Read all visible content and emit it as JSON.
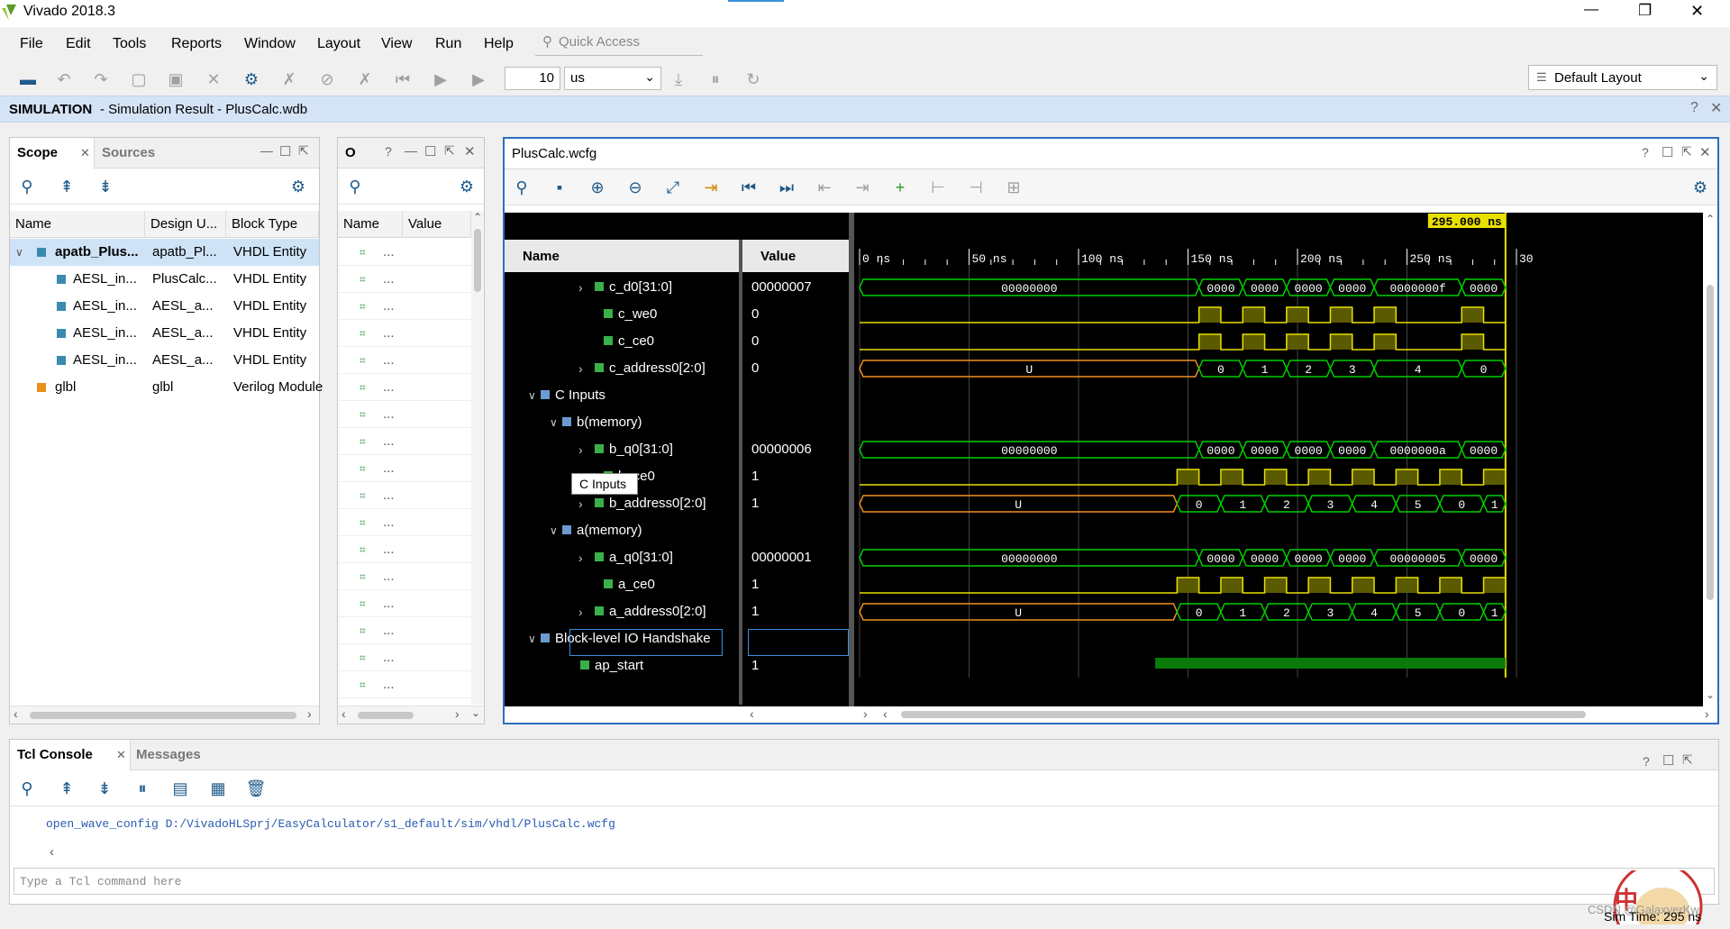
{
  "window": {
    "title": "Vivado 2018.3",
    "minimize": "—",
    "restore": "❐",
    "close": "✕"
  },
  "menu": [
    "File",
    "Edit",
    "Tools",
    "Reports",
    "Window",
    "Layout",
    "View",
    "Run",
    "Help"
  ],
  "quick_access": {
    "placeholder": "Quick Access"
  },
  "toolbar": {
    "run_time": "10",
    "time_unit": "us",
    "layout": "Default Layout"
  },
  "sim_banner": {
    "mode": "SIMULATION",
    "detail": " - Simulation Result - PlusCalc.wdb"
  },
  "scope_panel": {
    "tabs": [
      "Scope",
      "Sources"
    ],
    "columns": [
      "Name",
      "Design U...",
      "Block Type"
    ],
    "rows": [
      {
        "name": "apatb_Plus...",
        "design": "apatb_Pl...",
        "type": "VHDL Entity",
        "expanded": true,
        "selected": true
      },
      {
        "name": "AESL_in...",
        "design": "PlusCalc...",
        "type": "VHDL Entity"
      },
      {
        "name": "AESL_in...",
        "design": "AESL_a...",
        "type": "VHDL Entity"
      },
      {
        "name": "AESL_in...",
        "design": "AESL_a...",
        "type": "VHDL Entity"
      },
      {
        "name": "AESL_in...",
        "design": "AESL_a...",
        "type": "VHDL Entity"
      },
      {
        "name": "glbl",
        "design": "glbl",
        "type": "Verilog Module"
      }
    ]
  },
  "objects_panel": {
    "title": "O",
    "columns": [
      "Name",
      "Value"
    ],
    "ellipsis": "..."
  },
  "wave_panel": {
    "title": "PlusCalc.wcfg",
    "columns": [
      "Name",
      "Value"
    ],
    "cursor_label": "295.000 ns",
    "time_labels": [
      "0 ns",
      "50 ns",
      "100 ns",
      "150 ns",
      "200 ns",
      "250 ns",
      "30"
    ],
    "tooltip": "C Inputs",
    "signals": [
      {
        "name": "c_d0[31:0]",
        "value": "00000007"
      },
      {
        "name": "c_we0",
        "value": "0"
      },
      {
        "name": "c_ce0",
        "value": "0"
      },
      {
        "name": "c_address0[2:0]",
        "value": "0"
      },
      {
        "name": "C Inputs",
        "value": ""
      },
      {
        "name": "b(memory)",
        "value": ""
      },
      {
        "name": "b_q0[31:0]",
        "value": "00000006"
      },
      {
        "name": "b_ce0",
        "value": "1"
      },
      {
        "name": "b_address0[2:0]",
        "value": "1"
      },
      {
        "name": "a(memory)",
        "value": ""
      },
      {
        "name": "a_q0[31:0]",
        "value": "00000001"
      },
      {
        "name": "a_ce0",
        "value": "1"
      },
      {
        "name": "a_address0[2:0]",
        "value": "1"
      },
      {
        "name": "Block-level IO Handshake",
        "value": ""
      },
      {
        "name": "ap_start",
        "value": "1"
      }
    ],
    "bus_labels": {
      "c_d0": [
        "00000000",
        "0000",
        "0000",
        "0000",
        "0000",
        "0000000f",
        "0000"
      ],
      "c_address0": [
        "U",
        "0",
        "1",
        "2",
        "3",
        "4",
        "0"
      ],
      "b_q0": [
        "00000000",
        "0000",
        "0000",
        "0000",
        "0000",
        "0000000a",
        "0000"
      ],
      "b_address0": [
        "U",
        "0",
        "1",
        "2",
        "3",
        "4",
        "5",
        "0",
        "1"
      ],
      "a_q0": [
        "00000000",
        "0000",
        "0000",
        "0000",
        "0000",
        "00000005",
        "0000"
      ],
      "a_address0": [
        "U",
        "0",
        "1",
        "2",
        "3",
        "4",
        "5",
        "0",
        "1"
      ]
    }
  },
  "tcl": {
    "tabs": [
      "Tcl Console",
      "Messages"
    ],
    "log_line": "open_wave_config D:/VivadoHLSprj/EasyCalculator/s1_default/sim/vhdl/PlusCalc.wcfg",
    "input_placeholder": "Type a Tcl command here"
  },
  "status": {
    "sim_time": "Sim Time: 295 ns",
    "watermark": "CSDN @GalaxyerKw"
  },
  "colors": {
    "wave_green": "#00d000",
    "wave_yellow": "#e8e000",
    "wave_orange": "#f09020",
    "accent": "#2e6ebf"
  }
}
